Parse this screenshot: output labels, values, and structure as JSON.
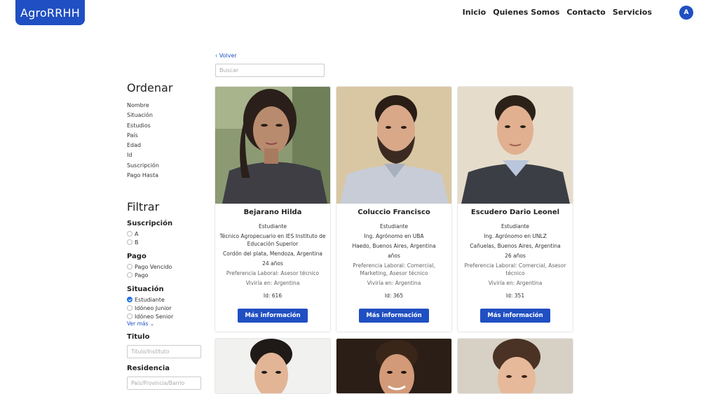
{
  "brand": "AgroRRHH",
  "nav": [
    "Inicio",
    "Quienes Somos",
    "Contacto",
    "Servicios"
  ],
  "avatar_initial": "A",
  "back_label": "‹ Volver",
  "search_placeholder": "Buscar",
  "sort": {
    "heading": "Ordenar",
    "items": [
      "Nombre",
      "Situación",
      "Estudios",
      "País",
      "Edad",
      "Id",
      "Suscripción",
      "Pago Hasta"
    ]
  },
  "filter": {
    "heading": "Filtrar",
    "suscripcion": {
      "title": "Suscripción",
      "options": [
        "A",
        "B"
      ]
    },
    "pago": {
      "title": "Pago",
      "options": [
        "Pago Vencido",
        "Pago"
      ]
    },
    "situacion": {
      "title": "Situación",
      "options": [
        "Estudiante",
        "Idóneo Junior",
        "Idóneo Senior"
      ],
      "selected": "Estudiante",
      "more": "Ver más ⌄"
    },
    "titulo": {
      "title": "Titulo",
      "placeholder": "Titulo/Instituto"
    },
    "residencia": {
      "title": "Residencia",
      "placeholder": "País/Provincia/Barrio"
    }
  },
  "cards": [
    {
      "name": "Bejarano Hilda",
      "role": "Estudiante",
      "study": "Técnico Agropecuario en IES Instituto de Educación Superior",
      "location": "Cordón del plata, Mendoza, Argentina",
      "age": "24 años",
      "preference": "Preferencia Laboral: Asesor técnico",
      "lives": "Viviría en: Argentina",
      "id": "Id: 616",
      "button": "Más información"
    },
    {
      "name": "Coluccio Francisco",
      "role": "Estudiante",
      "study": "Ing. Agrónomo en UBA",
      "location": "Haedo, Buenos Aires, Argentina",
      "age": "años",
      "preference": "Preferencia Laboral: Comercial, Marketing, Asesor técnico",
      "lives": "Viviría en: Argentina",
      "id": "Id: 365",
      "button": "Más información"
    },
    {
      "name": "Escudero Dario Leonel",
      "role": "Estudiante",
      "study": "Ing. Agrónomo en UNLZ",
      "location": "Cañuelas, Buenos Aires, Argentina",
      "age": "26 años",
      "preference": "Preferencia Laboral: Comercial, Asesor técnico",
      "lives": "Viviría en: Argentina",
      "id": "Id: 351",
      "button": "Más información"
    }
  ],
  "colors": {
    "primary": "#1f4fc2",
    "link": "#1f4fc2"
  }
}
